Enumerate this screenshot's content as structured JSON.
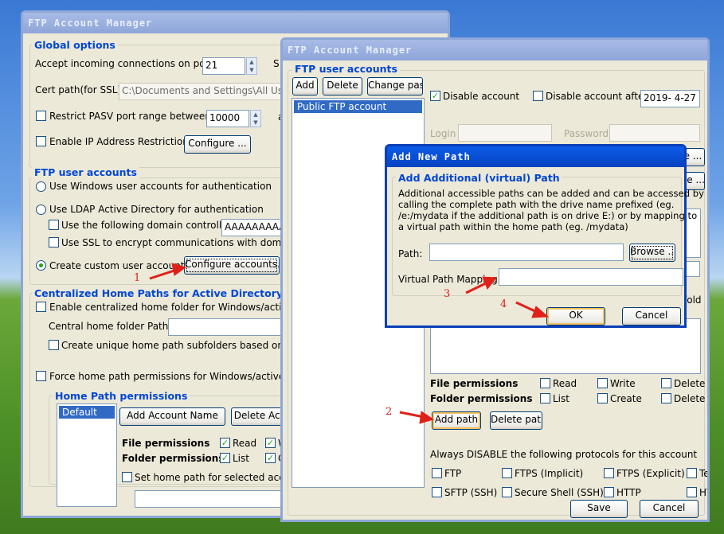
{
  "back": {
    "title": "FTP Account Manager",
    "global_label": "Global options",
    "port_label": "Accept incoming connections on port",
    "port_value": "21",
    "s_label": "S",
    "cert_label": "Cert path(for SSL)",
    "cert_value": "C:\\Documents and Settings\\All Users",
    "pasv_label": "Restrict PASV port range between",
    "pasv_value": "10000",
    "a_label": "a",
    "ip_label": "Enable IP Address Restriction",
    "configure_btn": "Configure ...",
    "users_label": "FTP user accounts",
    "opt1": "Use Windows user accounts for authentication",
    "opt2": "Use LDAP Active Directory for authentication",
    "dc_label": "Use the following domain controller",
    "dc_value": "AAAAAAAAA",
    "ssl_label": "Use SSL to encrypt communications with domain c",
    "opt3": "Create custom user accounts",
    "config_accounts_btn": "Configure accounts...",
    "central_label": "Centralized Home Paths for Active Directory or Wir",
    "central_cb": "Enable centralized home folder for Windows/active dir",
    "central_path_label": "Central home folder Path:",
    "unique_cb": "Create unique home path subfolders based on acco",
    "force_cb": "Force home path permissions for Windows/active dire",
    "hp_label": "Home Path permissions",
    "default_item": "Default",
    "add_account_btn": "Add Account Name",
    "delete_acc_btn": "Delete Acc",
    "file_perm": "File permissions",
    "folder_perm": "Folder permissions",
    "read": "Read",
    "w": "W",
    "list": "List",
    "c": "C",
    "set_home": "Set home path for selected accou"
  },
  "front": {
    "title": "FTP Account Manager",
    "users_label": "FTP user accounts",
    "add_btn": "Add",
    "delete_btn": "Delete",
    "change_btn": "Change pass",
    "account_item": "Public FTP account",
    "disable_account": "Disable account",
    "disable_after": "Disable account after",
    "date_value": "2019- 4-27",
    "login_label": "Login",
    "password_label": "Password",
    "partial_e": "e ...",
    "partial_se": "se ...",
    "partial_fold": "fold",
    "file_perm": "File permissions",
    "folder_perm": "Folder permissions",
    "read": "Read",
    "write": "Write",
    "delete": "Delete",
    "list": "List",
    "create": "Create",
    "add_path_btn": "Add path",
    "delete_path_btn": "Delete path",
    "protocols_label": "Always DISABLE the following protocols for this account",
    "ftp": "FTP",
    "ftps_imp": "FTPS (Implicit)",
    "ftps_exp": "FTPS (Explicit)",
    "te": "Te",
    "sftp": "SFTP (SSH)",
    "shell": "Secure Shell (SSH)",
    "http": "HTTP",
    "ht": "HT",
    "save_btn": "Save",
    "cancel_btn": "Cancel"
  },
  "dialog": {
    "title": "Add New Path",
    "group_label": "Add Additional (virtual) Path",
    "desc1": "Additional accessible paths can be added and can be accessed by",
    "desc2": "calling the complete path with the drive name prefixed (eg.",
    "desc3": "/e:/mydata if the additional path is on drive E:) or by mapping to",
    "desc4": "a virtual path within the home path (eg. /mydata)",
    "path_label": "Path:",
    "browse_btn": "Browse ...",
    "mapping_label": "Virtual Path Mapping:",
    "ok_btn": "OK",
    "cancel_btn": "Cancel"
  },
  "annotations": {
    "n1": "1",
    "n2": "2",
    "n3": "3",
    "n4": "4"
  },
  "colors": {
    "titlebar_active": "#0a5ce8",
    "group_label": "#0046d5",
    "annotation": "#e0201a",
    "selection": "#316ac5"
  }
}
